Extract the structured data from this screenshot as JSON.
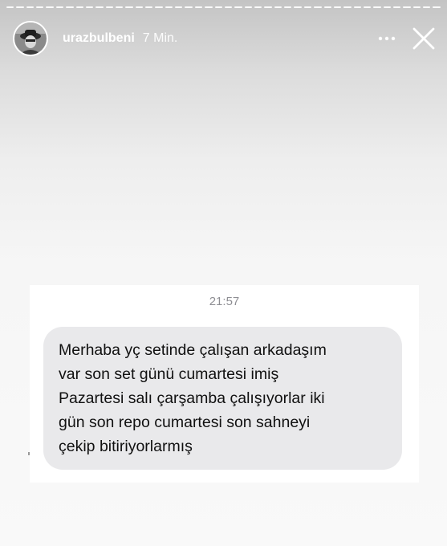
{
  "story": {
    "username": "urazbulbeni",
    "time_ago": "7 Min.",
    "progress_segments": 44
  },
  "icons": {
    "more": "more-horizontal-icon",
    "close": "close-icon",
    "avatar": "profile-avatar"
  },
  "message": {
    "timestamp": "21:57",
    "lines": [
      "Merhaba yç setinde çalışan arkadaşım",
      "var son set günü cumartesi imiş",
      "Pazartesi salı çarşamba çalışıyorlar iki",
      "gün son repo cumartesi son sahneyi",
      "çekip bitiriyorlarmış"
    ]
  },
  "colors": {
    "bubble": "#e9e9eb",
    "timestamp": "#8e8e93",
    "header_text": "#ffffff"
  }
}
